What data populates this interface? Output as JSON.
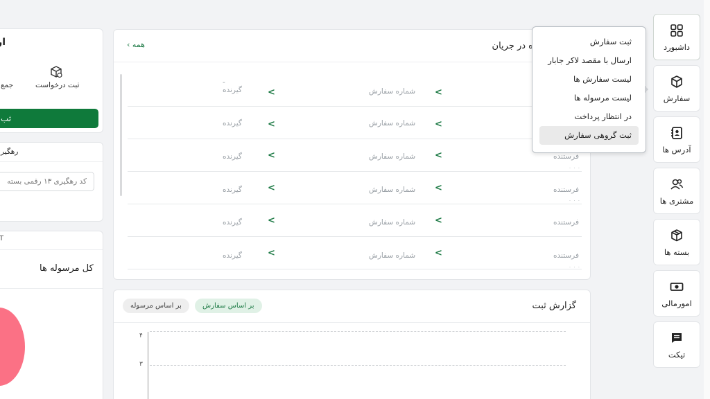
{
  "sidebar": {
    "items": [
      {
        "label": "داشبورد",
        "icon": "grid-icon"
      },
      {
        "label": "سفارش",
        "icon": "box-icon"
      },
      {
        "label": "آدرس ها",
        "icon": "address-book-icon"
      },
      {
        "label": "مشتری ها",
        "icon": "customers-icon"
      },
      {
        "label": "بسته ها",
        "icon": "package-icon"
      },
      {
        "label": "امورمالی",
        "icon": "money-icon"
      },
      {
        "label": "تیکت",
        "icon": "ticket-icon"
      }
    ]
  },
  "popup": {
    "items": [
      {
        "label": "ثبت سفارش"
      },
      {
        "label": "ارسال با مقصد لاکر جابار"
      },
      {
        "label": "لیست سفارش ها"
      },
      {
        "label": "لیست مرسوله ها"
      },
      {
        "label": "در انتظار پرداخت"
      },
      {
        "label": "ثبت گروهی سفارش"
      }
    ]
  },
  "shipments": {
    "title": "ه در جریان",
    "all_link": "همه",
    "rows": [
      {
        "receiver": "گیرنده",
        "order": "شماره سفارش",
        "sender": ""
      },
      {
        "receiver": "گیرنده",
        "order": "شماره سفارش",
        "sender": ""
      },
      {
        "receiver": "گیرنده",
        "order": "شماره سفارش",
        "sender": "فرستنده"
      },
      {
        "receiver": "گیرنده",
        "order": "شماره سفارش",
        "sender": "فرستنده"
      },
      {
        "receiver": "گیرنده",
        "order": "شماره سفارش",
        "sender": "فرستنده"
      },
      {
        "receiver": "گیرنده",
        "order": "شماره سفارش",
        "sender": "فرستنده"
      }
    ]
  },
  "report": {
    "title": "گزارش ثبت",
    "tab_order": "بر اساس سفارش",
    "tab_parcel": "بر اساس مرسوله",
    "y_ticks": [
      "۴",
      "۳"
    ]
  },
  "left": {
    "card_title": "ارس",
    "request_label": "ثبت درخواست",
    "collect_label": "جمع",
    "button_label": "ثب",
    "tracking_title": "رهگیر",
    "tracking_placeholder": "کد رهگیری ۱۳ رقمی بسته",
    "stats_tag": "T",
    "stats_title": "کل مرسوله ها"
  },
  "colors": {
    "brand_green": "#0f7a3b",
    "accent_pink": "#fb7185"
  }
}
